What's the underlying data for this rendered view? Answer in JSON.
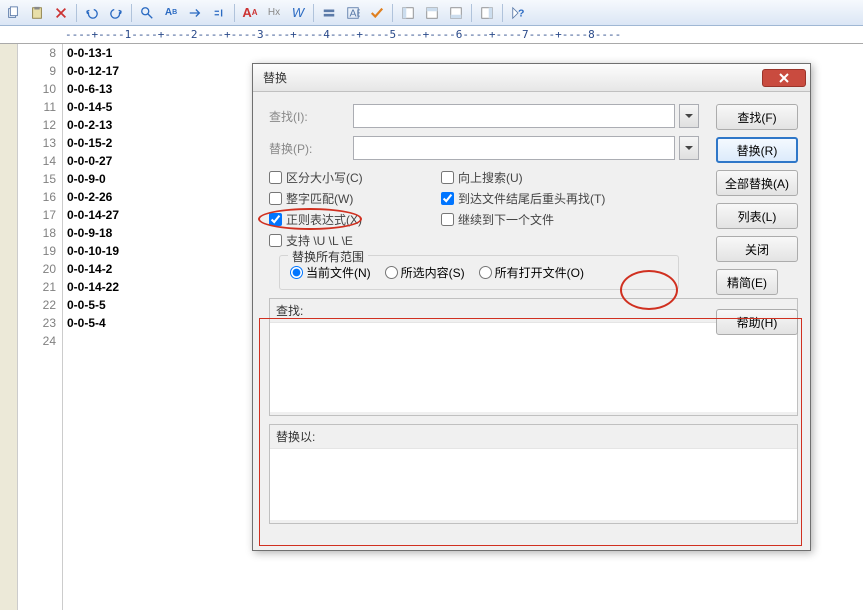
{
  "toolbar": {
    "icons": [
      "copy-icon",
      "paste-icon",
      "delete-icon",
      "",
      "undo-icon",
      "redo-icon",
      "",
      "search-icon",
      "find-char-icon",
      "goto-icon",
      "bookmark-icon",
      "",
      "font-size-icon",
      "hex-icon",
      "wrap-icon",
      "",
      "highlight-icon",
      "block-icon",
      "check-icon",
      "",
      "panel1-icon",
      "panel2-icon",
      "panel3-icon",
      "",
      "panel4-icon",
      "",
      "help-icon"
    ]
  },
  "ruler": "----+----1----+----2----+----3----+----4----+----5----+----6----+----7----+----8----",
  "lines": [
    {
      "n": "8",
      "t": "0-0-13-1"
    },
    {
      "n": "9",
      "t": "0-0-12-17"
    },
    {
      "n": "10",
      "t": "0-0-6-13"
    },
    {
      "n": "11",
      "t": "0-0-14-5"
    },
    {
      "n": "12",
      "t": "0-0-2-13"
    },
    {
      "n": "13",
      "t": "0-0-15-2"
    },
    {
      "n": "14",
      "t": "0-0-0-27"
    },
    {
      "n": "15",
      "t": "0-0-9-0"
    },
    {
      "n": "16",
      "t": "0-0-2-26"
    },
    {
      "n": "17",
      "t": "0-0-14-27"
    },
    {
      "n": "18",
      "t": "0-0-9-18"
    },
    {
      "n": "19",
      "t": "0-0-10-19"
    },
    {
      "n": "20",
      "t": "0-0-14-2"
    },
    {
      "n": "21",
      "t": "0-0-14-22"
    },
    {
      "n": "22",
      "t": "0-0-5-5"
    },
    {
      "n": "23",
      "t": "0-0-5-4"
    },
    {
      "n": "24",
      "t": ""
    }
  ],
  "dialog": {
    "title": "替换",
    "find_label": "查找(I):",
    "replace_label": "替换(P):",
    "find_value": "",
    "replace_value": "",
    "btns": {
      "find": "查找(F)",
      "replace": "替换(R)",
      "replace_all": "全部替换(A)",
      "list": "列表(L)",
      "close": "关闭",
      "simple": "精简(E)",
      "help": "帮助(H)"
    },
    "opts": {
      "case": "区分大小写(C)",
      "whole": "整字匹配(W)",
      "regex": "正则表达式(X)",
      "backslash": "支持 \\U \\L \\E",
      "up": "向上搜索(U)",
      "eof": "到达文件结尾后重头再找(T)",
      "next_file": "继续到下一个文件"
    },
    "scope": {
      "title": "替换所有范围",
      "current": "当前文件(N)",
      "selection": "所选内容(S)",
      "all_open": "所有打开文件(O)"
    },
    "ml_find": "查找:",
    "ml_replace": "替换以:"
  }
}
